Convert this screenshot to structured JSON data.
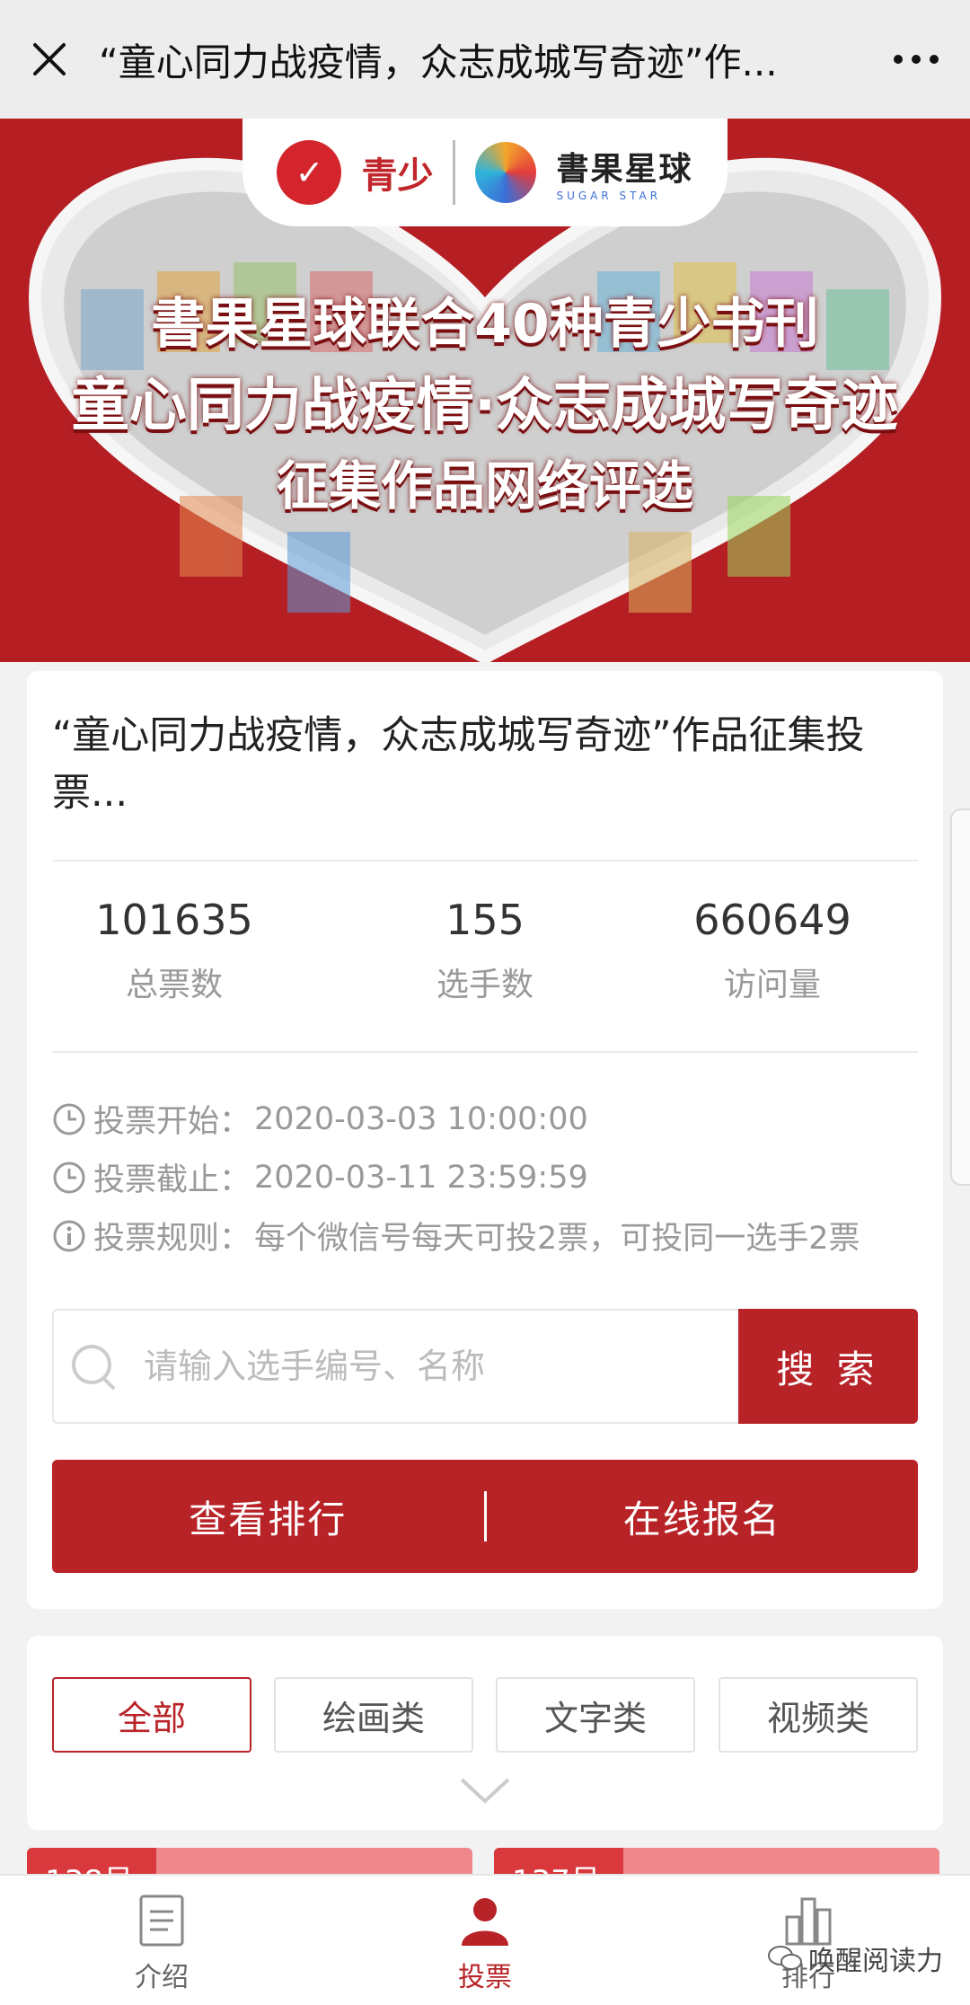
{
  "topbar": {
    "title": "“童心同力战疫情，众志成城写奇迹”作..."
  },
  "banner": {
    "logo_left_text": "青少",
    "logo_right_cn": "書果星球",
    "logo_right_en": "SUGAR STAR",
    "line1": "書果星球联合40种青少书刊",
    "line2": "童心同力战疫情·众志成城写奇迹",
    "line3": "征集作品网络评选",
    "colors": {
      "bg": "#b51f24",
      "heart": "#e8e8e8"
    }
  },
  "info": {
    "title": "“童心同力战疫情，众志成城写奇迹”作品征集投票...",
    "stats": [
      {
        "value": "101635",
        "label": "总票数"
      },
      {
        "value": "155",
        "label": "选手数"
      },
      {
        "value": "660649",
        "label": "访问量"
      }
    ],
    "start_label": "投票开始：",
    "start_value": "2020-03-03 10:00:00",
    "end_label": "投票截止：",
    "end_value": "2020-03-11 23:59:59",
    "rule_label": "投票规则：",
    "rule_value": "每个微信号每天可投2票，可投同一选手2票"
  },
  "search": {
    "placeholder": "请输入选手编号、名称",
    "button_label": "搜 索"
  },
  "actions": {
    "ranking_label": "查看排行",
    "signup_label": "在线报名"
  },
  "categories": {
    "items": [
      "全部",
      "绘画类",
      "文字类",
      "视频类"
    ],
    "active": "全部"
  },
  "entries": [
    {
      "tag": "138号"
    },
    {
      "tag": "137号"
    }
  ],
  "nav": {
    "items": [
      {
        "label": "介绍",
        "icon": "document-icon"
      },
      {
        "label": "投票",
        "icon": "user-icon"
      },
      {
        "label": "排行",
        "icon": "bar-chart-icon"
      }
    ],
    "active": "投票"
  },
  "watermark": "唤醒阅读力",
  "theme": {
    "accent": "#b82328",
    "muted": "#999999"
  }
}
